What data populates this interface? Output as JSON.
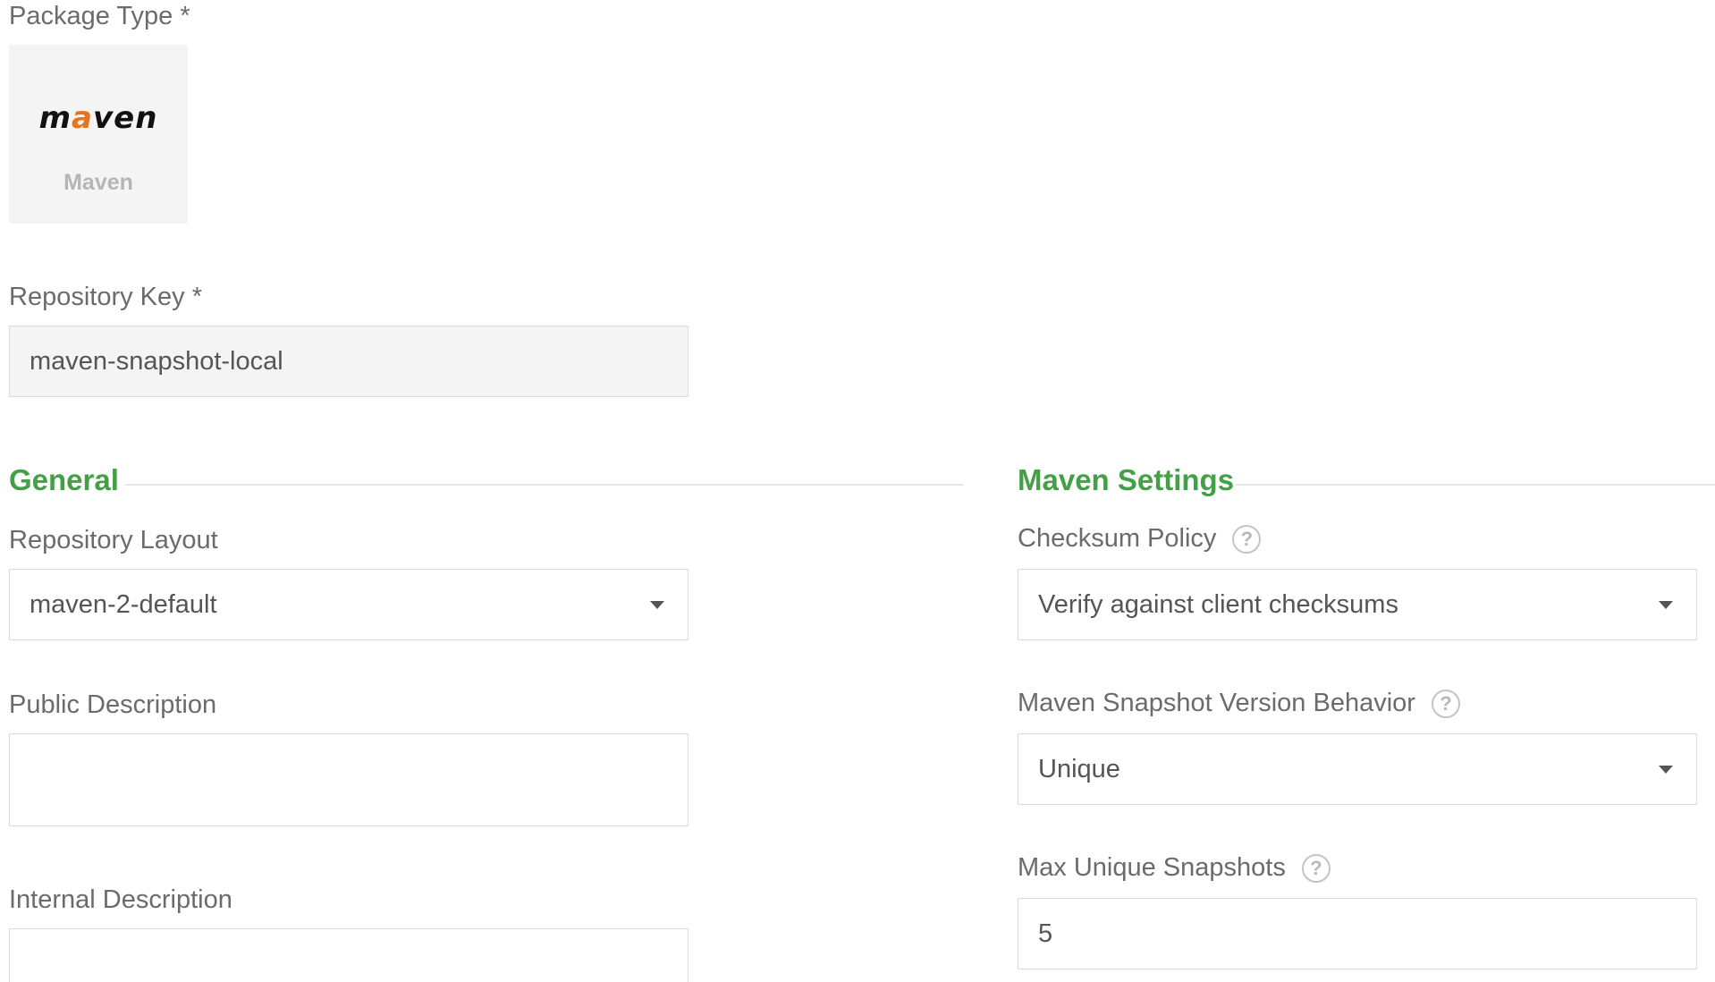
{
  "package_type": {
    "label": "Package Type *",
    "logo_text_prefix": "m",
    "logo_text_accent": "a",
    "logo_text_suffix": "ven",
    "name": "Maven"
  },
  "repository_key": {
    "label": "Repository Key *",
    "value": "maven-snapshot-local"
  },
  "general": {
    "title": "General",
    "repository_layout": {
      "label": "Repository Layout",
      "value": "maven-2-default"
    },
    "public_description": {
      "label": "Public Description",
      "value": ""
    },
    "internal_description": {
      "label": "Internal Description",
      "value": ""
    }
  },
  "maven_settings": {
    "title": "Maven Settings",
    "checksum_policy": {
      "label": "Checksum Policy",
      "value": "Verify against client checksums"
    },
    "snapshot_version_behavior": {
      "label": "Maven Snapshot Version Behavior",
      "value": "Unique"
    },
    "max_unique_snapshots": {
      "label": "Max Unique Snapshots",
      "value": "5"
    }
  },
  "icons": {
    "help": "question-mark-circle-icon",
    "dropdown": "caret-down-icon"
  },
  "colors": {
    "section_title": "#43a047",
    "logo_accent": "#e8731e",
    "tile_background": "#f4f4f4",
    "input_border": "#dcdcdc"
  }
}
